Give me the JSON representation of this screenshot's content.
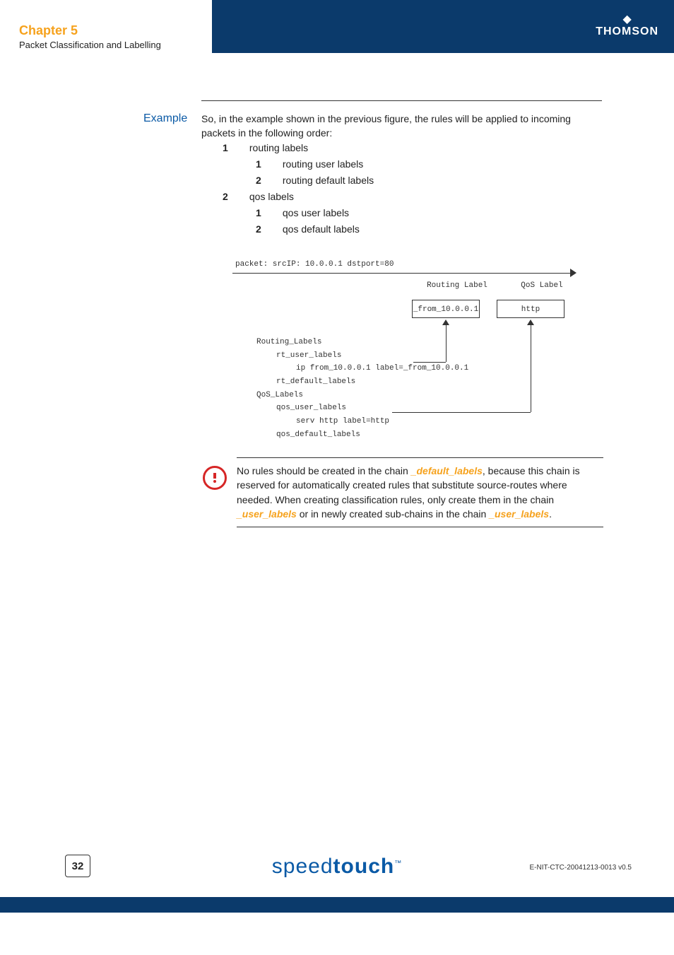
{
  "header": {
    "chapter": "Chapter 5",
    "subtitle": "Packet Classification and Labelling",
    "brand": "THOMSON"
  },
  "section": {
    "label": "Example",
    "intro": "So, in the example shown in the previous figure, the rules will be applied to incoming packets in the following order:",
    "list": {
      "item1": {
        "num": "1",
        "text": "routing labels"
      },
      "item1_1": {
        "num": "1",
        "text": "routing user labels"
      },
      "item1_2": {
        "num": "2",
        "text": "routing default labels"
      },
      "item2": {
        "num": "2",
        "text": "qos labels"
      },
      "item2_1": {
        "num": "1",
        "text": "qos user labels"
      },
      "item2_2": {
        "num": "2",
        "text": "qos default labels"
      }
    }
  },
  "diagram": {
    "packet": "packet: srcIP: 10.0.0.1 dstport=80",
    "col_routing": "Routing Label",
    "col_qos": "QoS Label",
    "val_routing": "_from_10.0.0.1",
    "val_qos": "http",
    "tree": {
      "l1": "Routing_Labels",
      "l2": "rt_user_labels",
      "l3": "ip from_10.0.0.1 label=_from_10.0.0.1",
      "l4": "rt_default_labels",
      "l5": "QoS_Labels",
      "l6": "qos_user_labels",
      "l7": "serv http label=http",
      "l8": "qos_default_labels"
    }
  },
  "note": {
    "pre1": "No rules should be created in the chain ",
    "em1": "_default_labels",
    "mid1": ", because this chain is reserved for automatically created rules that substitute source-routes where needed. When creating classification rules, only create them in the chain ",
    "em2": "_user_labels",
    "mid2": " or in newly created sub-chains in the chain ",
    "em3": "_user_labels",
    "end": "."
  },
  "footer": {
    "page": "32",
    "brand_light": "speed",
    "brand_bold": "touch",
    "tm": "™",
    "docid": "E-NIT-CTC-20041213-0013 v0.5"
  }
}
